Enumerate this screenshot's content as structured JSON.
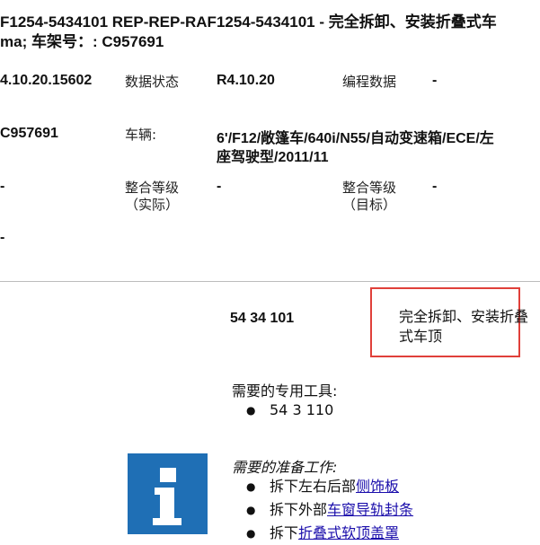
{
  "header": {
    "line1": "F1254-5434101   REP-REP-RAF1254-5434101 - 完全拆卸、安装折叠式车",
    "line2": "ma; 车架号：: C957691"
  },
  "info": {
    "data_value": "4.10.20.15602",
    "status_label": "数据状态",
    "status_value": "R4.10.20",
    "prog_label": "编程数据",
    "prog_value": "-",
    "vin_value": "C957691",
    "vehicle_label": "车辆:",
    "vehicle_line1": "6'/F12/敞篷车/640i/N55/自动变速箱/ECE/左",
    "vehicle_line2": "座驾驶型/2011/11",
    "dash1": "-",
    "integ_actual_label1": "整合等级",
    "integ_actual_label2": "（实际）",
    "integ_actual_value": "-",
    "integ_target_label1": "整合等级",
    "integ_target_label2": "（目标）",
    "integ_target_value": "-",
    "dash2": "-"
  },
  "procedure": {
    "number": "54 34 101",
    "title": "完全拆卸、安装折叠式车顶"
  },
  "tools": {
    "heading": "需要的专用工具:",
    "items": [
      "54 3 110"
    ]
  },
  "prep": {
    "heading": "需要的准备工作:",
    "items": [
      {
        "prefix": "拆下左右后部",
        "link": "侧饰板"
      },
      {
        "prefix": "拆下外部",
        "link": "车窗导轨封条"
      },
      {
        "prefix": "拆下",
        "link": "折叠式软顶盖罩"
      }
    ]
  },
  "colors": {
    "highlight_border": "#e0403a",
    "info_icon_bg": "#1f6fb5",
    "link": "#1a0dab"
  },
  "icons": {
    "info": "info-icon",
    "bullet": "bullet-icon"
  }
}
